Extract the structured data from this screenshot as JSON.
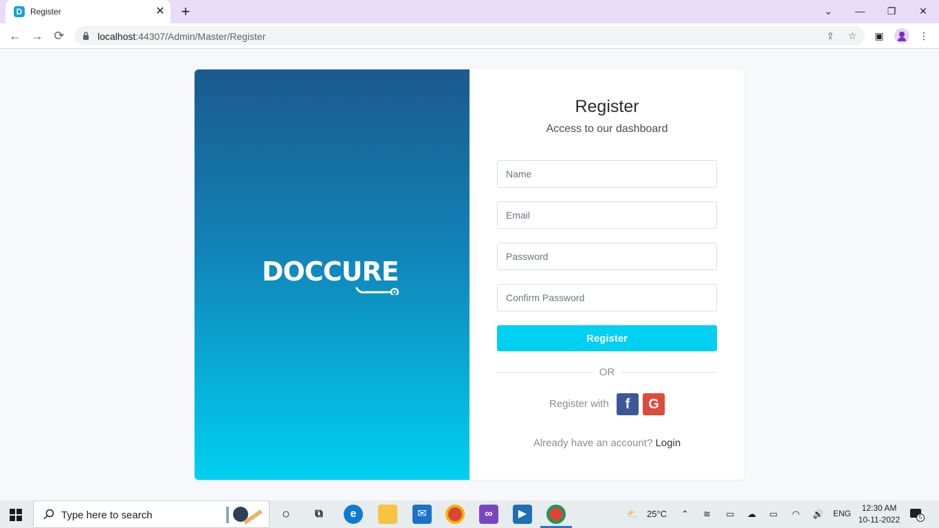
{
  "browser": {
    "tab_title": "Register",
    "favicon_letter": "D",
    "url_host": "localhost",
    "url_rest": ":44307/Admin/Master/Register"
  },
  "brand": {
    "logo_text": "DOCCURE",
    "gradient_top": "#1b5a8e",
    "gradient_bottom": "#00d0f1"
  },
  "form": {
    "title": "Register",
    "subtitle": "Access to our dashboard",
    "name_placeholder": "Name",
    "email_placeholder": "Email",
    "password_placeholder": "Password",
    "confirm_placeholder": "Confirm Password",
    "submit_label": "Register",
    "accent_color": "#00d0f1",
    "or_text": "OR",
    "social_label": "Register with",
    "facebook_glyph": "f",
    "google_glyph": "G",
    "have_account_text": "Already have an account?",
    "login_link": "Login"
  },
  "taskbar": {
    "search_placeholder": "Type here to search",
    "weather": "25°C",
    "language": "ENG",
    "time": "12:30 AM",
    "date": "10-11-2022",
    "notification_count": "5"
  }
}
